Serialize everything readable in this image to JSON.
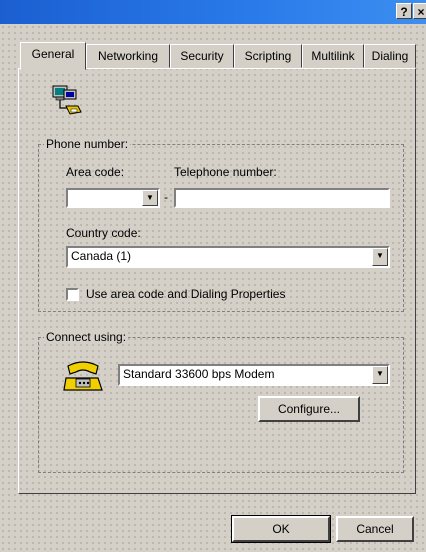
{
  "window": {
    "help_glyph": "?",
    "close_glyph": "×"
  },
  "tabs": [
    {
      "label": "General"
    },
    {
      "label": "Networking"
    },
    {
      "label": "Security"
    },
    {
      "label": "Scripting"
    },
    {
      "label": "Multilink"
    },
    {
      "label": "Dialing"
    }
  ],
  "phone_group": {
    "title": "Phone number:",
    "area_code_label": "Area code:",
    "area_code_value": "",
    "separator": "-",
    "telephone_label": "Telephone number:",
    "telephone_value": "",
    "country_label": "Country code:",
    "country_value": "Canada (1)",
    "use_dialing_label": "Use area code and Dialing Properties",
    "use_dialing_checked": false
  },
  "connect_group": {
    "title": "Connect using:",
    "device_value": "Standard 33600 bps Modem",
    "configure_label": "Configure..."
  },
  "footer": {
    "ok_label": "OK",
    "cancel_label": "Cancel"
  }
}
